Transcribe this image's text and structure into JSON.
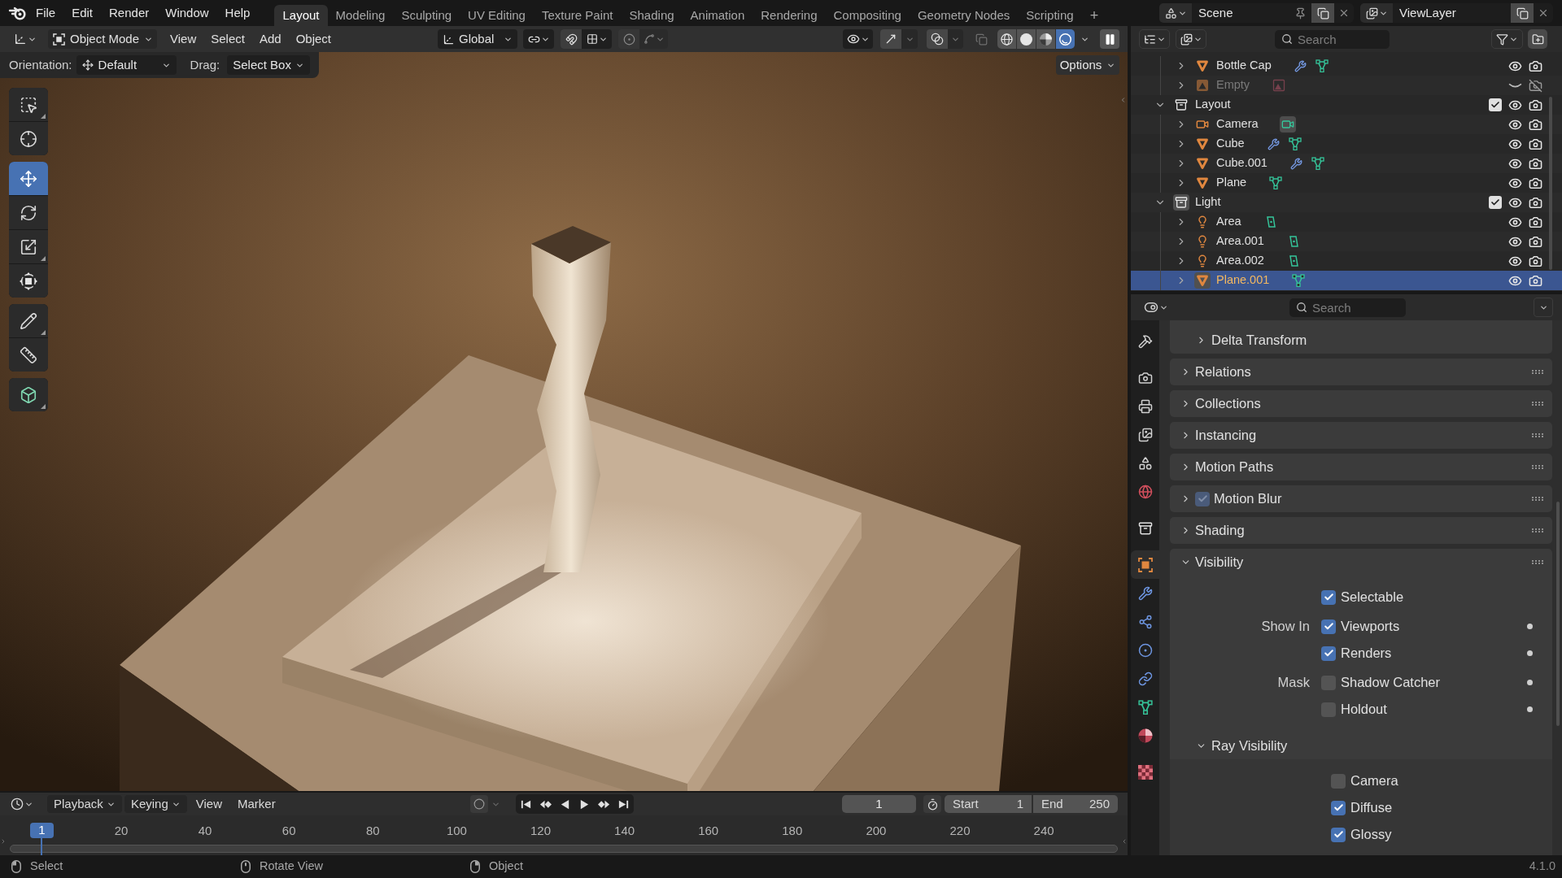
{
  "topbar": {
    "menus": [
      "File",
      "Edit",
      "Render",
      "Window",
      "Help"
    ],
    "workspaces": [
      {
        "label": "Layout",
        "selected": true
      },
      {
        "label": "Modeling",
        "selected": false
      },
      {
        "label": "Sculpting",
        "selected": false
      },
      {
        "label": "UV Editing",
        "selected": false
      },
      {
        "label": "Texture Paint",
        "selected": false
      },
      {
        "label": "Shading",
        "selected": false
      },
      {
        "label": "Animation",
        "selected": false
      },
      {
        "label": "Rendering",
        "selected": false
      },
      {
        "label": "Compositing",
        "selected": false
      },
      {
        "label": "Geometry Nodes",
        "selected": false
      },
      {
        "label": "Scripting",
        "selected": false
      }
    ],
    "add_workspace": "+",
    "scene": "Scene",
    "view_layer": "ViewLayer"
  },
  "viewport": {
    "header": {
      "mode": "Object Mode",
      "menus": [
        "View",
        "Select",
        "Add",
        "Object"
      ],
      "orientation": "Global",
      "snap": {
        "on": false
      },
      "proportional_editing": {
        "on": false
      },
      "gizmos": {
        "on": true
      },
      "overlays": {
        "on": true
      },
      "xray": {
        "on": false
      },
      "shading": [
        {
          "kind": "wireframe",
          "selected": false
        },
        {
          "kind": "solid",
          "selected": false
        },
        {
          "kind": "material",
          "selected": false
        },
        {
          "kind": "rendered",
          "selected": true
        }
      ]
    },
    "tool_settings": {
      "orientation_label": "Orientation:",
      "orientation": "Default",
      "drag_label": "Drag:",
      "drag": "Select Box",
      "options": "Options"
    },
    "tool_groups": [
      [
        {
          "kind": "select_box",
          "selected": false,
          "variants": true
        },
        {
          "kind": "cursor",
          "selected": false,
          "variants": false
        }
      ],
      [
        {
          "kind": "move",
          "selected": true,
          "variants": false
        },
        {
          "kind": "rotate",
          "selected": false,
          "variants": false
        },
        {
          "kind": "scale",
          "selected": false,
          "variants": true
        },
        {
          "kind": "transform",
          "selected": false,
          "variants": false
        }
      ],
      [
        {
          "kind": "annotate",
          "selected": false,
          "variants": true
        },
        {
          "kind": "measure",
          "selected": false,
          "variants": false
        }
      ],
      [
        {
          "kind": "add_cube",
          "selected": false,
          "variants": true
        }
      ]
    ]
  },
  "timeline": {
    "menus": [
      {
        "label": "Playback",
        "dropdown": true
      },
      {
        "label": "Keying",
        "dropdown": true
      },
      {
        "label": "View",
        "dropdown": false
      },
      {
        "label": "Marker",
        "dropdown": false
      }
    ],
    "current_frame": "1",
    "start_label": "Start",
    "start": "1",
    "end_label": "End",
    "end": "250",
    "playhead": "1",
    "ruler": [
      "20",
      "40",
      "60",
      "80",
      "100",
      "120",
      "140",
      "160",
      "180",
      "200",
      "220",
      "240"
    ]
  },
  "outliner": {
    "search": {
      "placeholder": "Search"
    },
    "rows": [
      {
        "kind": "collection_continued",
        "children": [
          {
            "kind": "mesh",
            "name": "Bottle Cap",
            "expanded": false,
            "selected": false,
            "visible": true,
            "renderable": true,
            "data": [
              {
                "kind": "modifier",
                "active": false
              },
              {
                "kind": "mesh_data",
                "active": false
              }
            ]
          },
          {
            "kind": "empty",
            "name": "Empty",
            "expanded": false,
            "selected": false,
            "visible": false,
            "renderable": false,
            "data": [
              {
                "kind": "image",
                "active": false
              }
            ]
          }
        ]
      },
      {
        "kind": "collection",
        "name": "Layout",
        "expanded": true,
        "selected": false,
        "active": false,
        "checked": true,
        "visible": true,
        "renderable": true,
        "children": [
          {
            "kind": "camera",
            "name": "Camera",
            "expanded": false,
            "selected": false,
            "visible": true,
            "renderable": true,
            "data": [
              {
                "kind": "camera_data",
                "active": true
              }
            ]
          },
          {
            "kind": "mesh",
            "name": "Cube",
            "expanded": false,
            "selected": false,
            "visible": true,
            "renderable": true,
            "data": [
              {
                "kind": "modifier",
                "active": false
              },
              {
                "kind": "mesh_data",
                "active": false
              }
            ]
          },
          {
            "kind": "mesh",
            "name": "Cube.001",
            "expanded": false,
            "selected": false,
            "visible": true,
            "renderable": true,
            "data": [
              {
                "kind": "modifier",
                "active": false
              },
              {
                "kind": "mesh_data",
                "active": false
              }
            ]
          },
          {
            "kind": "mesh",
            "name": "Plane",
            "expanded": false,
            "selected": false,
            "visible": true,
            "renderable": true,
            "data": [
              {
                "kind": "mesh_data",
                "active": false
              }
            ]
          }
        ]
      },
      {
        "kind": "collection",
        "name": "Light",
        "expanded": true,
        "selected": false,
        "active": true,
        "checked": true,
        "visible": true,
        "renderable": true,
        "children": [
          {
            "kind": "light",
            "name": "Area",
            "expanded": false,
            "selected": false,
            "visible": true,
            "renderable": true,
            "data": [
              {
                "kind": "light_data",
                "active": false
              }
            ]
          },
          {
            "kind": "light",
            "name": "Area.001",
            "expanded": false,
            "selected": false,
            "visible": true,
            "renderable": true,
            "data": [
              {
                "kind": "light_data",
                "active": false
              }
            ]
          },
          {
            "kind": "light",
            "name": "Area.002",
            "expanded": false,
            "selected": false,
            "visible": true,
            "renderable": true,
            "data": [
              {
                "kind": "light_data",
                "active": false
              }
            ]
          },
          {
            "kind": "mesh",
            "name": "Plane.001",
            "expanded": false,
            "selected": true,
            "visible": true,
            "renderable": true,
            "data": [
              {
                "kind": "mesh_data",
                "active": false
              }
            ]
          }
        ]
      }
    ]
  },
  "properties": {
    "search": {
      "placeholder": "Search"
    },
    "tab_groups": [
      [
        {
          "kind": "tool",
          "selected": false
        }
      ],
      [
        {
          "kind": "render",
          "selected": false
        },
        {
          "kind": "output",
          "selected": false
        },
        {
          "kind": "view_layer",
          "selected": false
        },
        {
          "kind": "scene",
          "selected": false
        },
        {
          "kind": "world",
          "selected": false
        }
      ],
      [
        {
          "kind": "collection",
          "selected": false
        }
      ],
      [
        {
          "kind": "object",
          "selected": true
        },
        {
          "kind": "modifiers",
          "selected": false
        },
        {
          "kind": "particles",
          "selected": false
        },
        {
          "kind": "physics",
          "selected": false
        },
        {
          "kind": "constraints",
          "selected": false
        },
        {
          "kind": "data",
          "selected": false
        },
        {
          "kind": "material",
          "selected": false
        }
      ],
      [
        {
          "kind": "texture",
          "selected": false
        }
      ]
    ],
    "panels": [
      {
        "kind": "subpanel",
        "label": "Delta Transform",
        "expanded": false
      },
      {
        "kind": "panel",
        "label": "Relations",
        "expanded": false
      },
      {
        "kind": "panel",
        "label": "Collections",
        "expanded": false
      },
      {
        "kind": "panel",
        "label": "Instancing",
        "expanded": false
      },
      {
        "kind": "panel",
        "label": "Motion Paths",
        "expanded": false
      },
      {
        "kind": "panel",
        "label": "Motion Blur",
        "expanded": false,
        "checkbox": {
          "checked": true,
          "inactive": true
        }
      },
      {
        "kind": "panel",
        "label": "Shading",
        "expanded": false
      },
      {
        "kind": "panel",
        "label": "Visibility",
        "expanded": true,
        "rows": [
          {
            "label": "Selectable",
            "checked": true,
            "decorator": false
          },
          {
            "group_label": "Show In",
            "label": "Viewports",
            "checked": true,
            "decorator": true
          },
          {
            "label": "Renders",
            "checked": true,
            "decorator": true
          },
          {
            "group_label": "Mask",
            "label": "Shadow Catcher",
            "checked": false,
            "decorator": true
          },
          {
            "label": "Holdout",
            "checked": false,
            "decorator": true
          }
        ],
        "subpanels": [
          {
            "label": "Ray Visibility",
            "expanded": true,
            "rows": [
              {
                "label": "Camera",
                "checked": false,
                "decorator": false
              },
              {
                "label": "Diffuse",
                "checked": true,
                "decorator": false
              },
              {
                "label": "Glossy",
                "checked": true,
                "decorator": false
              }
            ]
          }
        ]
      }
    ]
  },
  "status_bar": {
    "items": [
      {
        "kind": "left_click",
        "label": "Select"
      },
      {
        "kind": "middle_click",
        "label": "Rotate View"
      },
      {
        "kind": "right_click",
        "label": "Object"
      }
    ],
    "version": "4.1.0"
  }
}
